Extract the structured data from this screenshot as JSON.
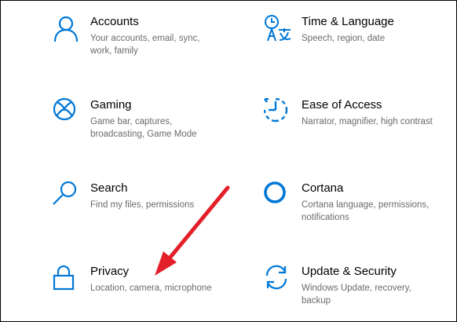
{
  "tiles": [
    {
      "id": "accounts",
      "title": "Accounts",
      "desc": "Your accounts, email, sync, work, family",
      "icon": "person-icon"
    },
    {
      "id": "time-language",
      "title": "Time & Language",
      "desc": "Speech, region, date",
      "icon": "time-language-icon"
    },
    {
      "id": "gaming",
      "title": "Gaming",
      "desc": "Game bar, captures, broadcasting, Game Mode",
      "icon": "xbox-icon"
    },
    {
      "id": "ease-of-access",
      "title": "Ease of Access",
      "desc": "Narrator, magnifier, high contrast",
      "icon": "ease-of-access-icon"
    },
    {
      "id": "search",
      "title": "Search",
      "desc": "Find my files, permissions",
      "icon": "search-icon"
    },
    {
      "id": "cortana",
      "title": "Cortana",
      "desc": "Cortana language, permissions, notifications",
      "icon": "cortana-icon"
    },
    {
      "id": "privacy",
      "title": "Privacy",
      "desc": "Location, camera, microphone",
      "icon": "lock-icon"
    },
    {
      "id": "update-security",
      "title": "Update & Security",
      "desc": "Windows Update, recovery, backup",
      "icon": "sync-icon"
    }
  ],
  "colors": {
    "accent": "#0078d7",
    "title": "#000000",
    "desc": "#6b6b6b",
    "arrow": "#e3202a"
  }
}
